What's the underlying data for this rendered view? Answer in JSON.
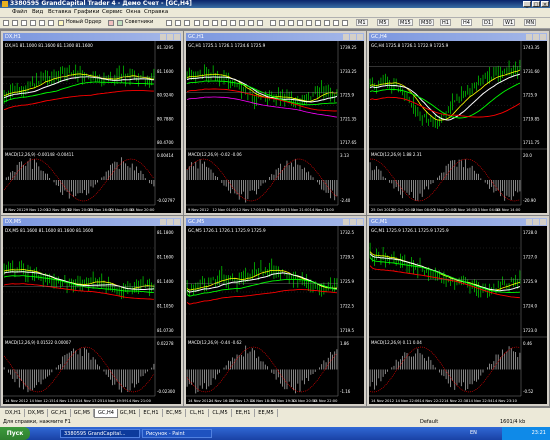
{
  "app": {
    "title": "3380595 GrandCapital Trader 4 - Демо Счет - [GC,H4]",
    "window_buttons": [
      "_",
      "□",
      "×"
    ]
  },
  "menu": [
    "Файл",
    "Вид",
    "Вставка",
    "Графики",
    "Сервис",
    "Окна",
    "Справка"
  ],
  "toolbar": {
    "new_order": "Новый Ордер",
    "experts": "Советники",
    "timeframes": [
      "M1",
      "M5",
      "M15",
      "M30",
      "H1",
      "H4",
      "D1",
      "W1",
      "MN"
    ]
  },
  "charts": [
    {
      "title": "DX,H1",
      "header": "DX,H1  81.1000 81.1600 81.1300 81.1600",
      "indicator": "MACD(12,26,9) -0.00148 -0.00411",
      "prices": [
        "81.3295",
        "81.1600",
        "80.9240",
        "80.7880",
        "80.4700"
      ],
      "macd_scale": [
        "0.00414",
        "-0.02797"
      ],
      "dates": [
        "8 Nov 2012",
        "9 Nov 12:00",
        "12 Nov 08:00",
        "12 Nov 20:00",
        "13 Nov 16:00",
        "14 Nov 08:00",
        "14 Nov 20:00"
      ]
    },
    {
      "title": "GC,H1",
      "header": "GC,H1  1725.1 1726.1 1724.6 1725.9",
      "indicator": "MACD(12,26,9) -0.02 -0.06",
      "prices": [
        "1739.25",
        "1733.25",
        "1725.9",
        "1721.35",
        "1717.65"
      ],
      "macd_scale": [
        "3.13",
        "-2.40"
      ],
      "dates": [
        "9 Nov 2012",
        "12 Nov 01:00",
        "12 Nov 17:00",
        "13 Nov 09:00",
        "13 Nov 21:00",
        "14 Nov 13:00"
      ]
    },
    {
      "title": "GC,H4",
      "header": "GC,H4  1725.8 1726.1 1722.9 1725.9",
      "indicator": "MACD(12,26,9) 1.88 2.31",
      "prices": [
        "1743.35",
        "1731.60",
        "1725.9",
        "1719.85",
        "1711.75"
      ],
      "macd_scale": [
        "20.0",
        "-20.90"
      ],
      "dates": [
        "25 Oct 2012",
        "30 Oct 20:00",
        "2 Nov 08:00",
        "5 Nov 20:00",
        "8 Nov 16:00",
        "13 Nov 04:00",
        "14 Nov 14:00"
      ]
    },
    {
      "title": "DX,M5",
      "header": "DX,M5  81.1600 81.1600 81.1600 81.1600",
      "indicator": "MACD(12,26,9) 0.01522 0.00007",
      "prices": [
        "81.1800",
        "81.1600",
        "81.1400",
        "81.1050",
        "81.0730"
      ],
      "macd_scale": [
        "0.02278",
        "-0.02300"
      ],
      "dates": [
        "14 Nov 2012",
        "14 Nov 12:15",
        "14 Nov 13:10",
        "14 Nov 17:25",
        "14 Nov 19:59",
        "14 Nov 21:00"
      ]
    },
    {
      "title": "GC,M5",
      "header": "GC,M5  1726.1 1726.1 1725.9 1725.9",
      "indicator": "MACD(12,26,9) -0.44 -0.62",
      "prices": [
        "1732.5",
        "1729.5",
        "1725.9",
        "1722.5",
        "1719.5"
      ],
      "macd_scale": [
        "1.86",
        "-1.16"
      ],
      "dates": [
        "14 Nov 2012",
        "14 Nov 16:10",
        "14 Nov 17:10",
        "14 Nov 18:30",
        "14 Nov 19:30",
        "14 Nov 20:50",
        "14 Nov 22:00"
      ]
    },
    {
      "title": "GC,M1",
      "header": "GC,M1  1725.9 1726.1 1725.9 1725.9",
      "indicator": "MACD(12,26,9) 0.11 0.04",
      "prices": [
        "1728.0",
        "1727.0",
        "1725.9",
        "1724.0",
        "1723.0"
      ],
      "macd_scale": [
        "0.46",
        "-0.52"
      ],
      "dates": [
        "14 Nov 2012",
        "14 Nov 22:06",
        "14 Nov 22:22",
        "14 Nov 22:38",
        "14 Nov 22:54",
        "14 Nov 23:10"
      ]
    }
  ],
  "tabs": [
    "DX,H1",
    "DX,M5",
    "GC,H1",
    "GC,M5",
    "GC,H4",
    "GC,M1",
    "EC,H1",
    "EC,M5",
    "CL,H1",
    "CL,M5",
    "EE,H1",
    "EE,M5"
  ],
  "active_tab": "GC,H4",
  "status": {
    "help": "Для справки, нажмите F1",
    "default": "Default",
    "traffic": "1601/4 kb"
  },
  "taskbar": {
    "start": "Пуск",
    "tasks": [
      "3380595 GrandCapital...",
      "Рисунок - Paint"
    ],
    "time": "23:21",
    "lang": "EN"
  },
  "colors": {
    "bg": "#000000",
    "bull_candles": "#00ff00",
    "ma_white": "#ffffff",
    "ma_green": "#00ff00",
    "ma_red": "#ff0000",
    "ma_yellow": "#ffff00",
    "macd_hist": "#c0c0c0",
    "signal": "#ff0000"
  }
}
